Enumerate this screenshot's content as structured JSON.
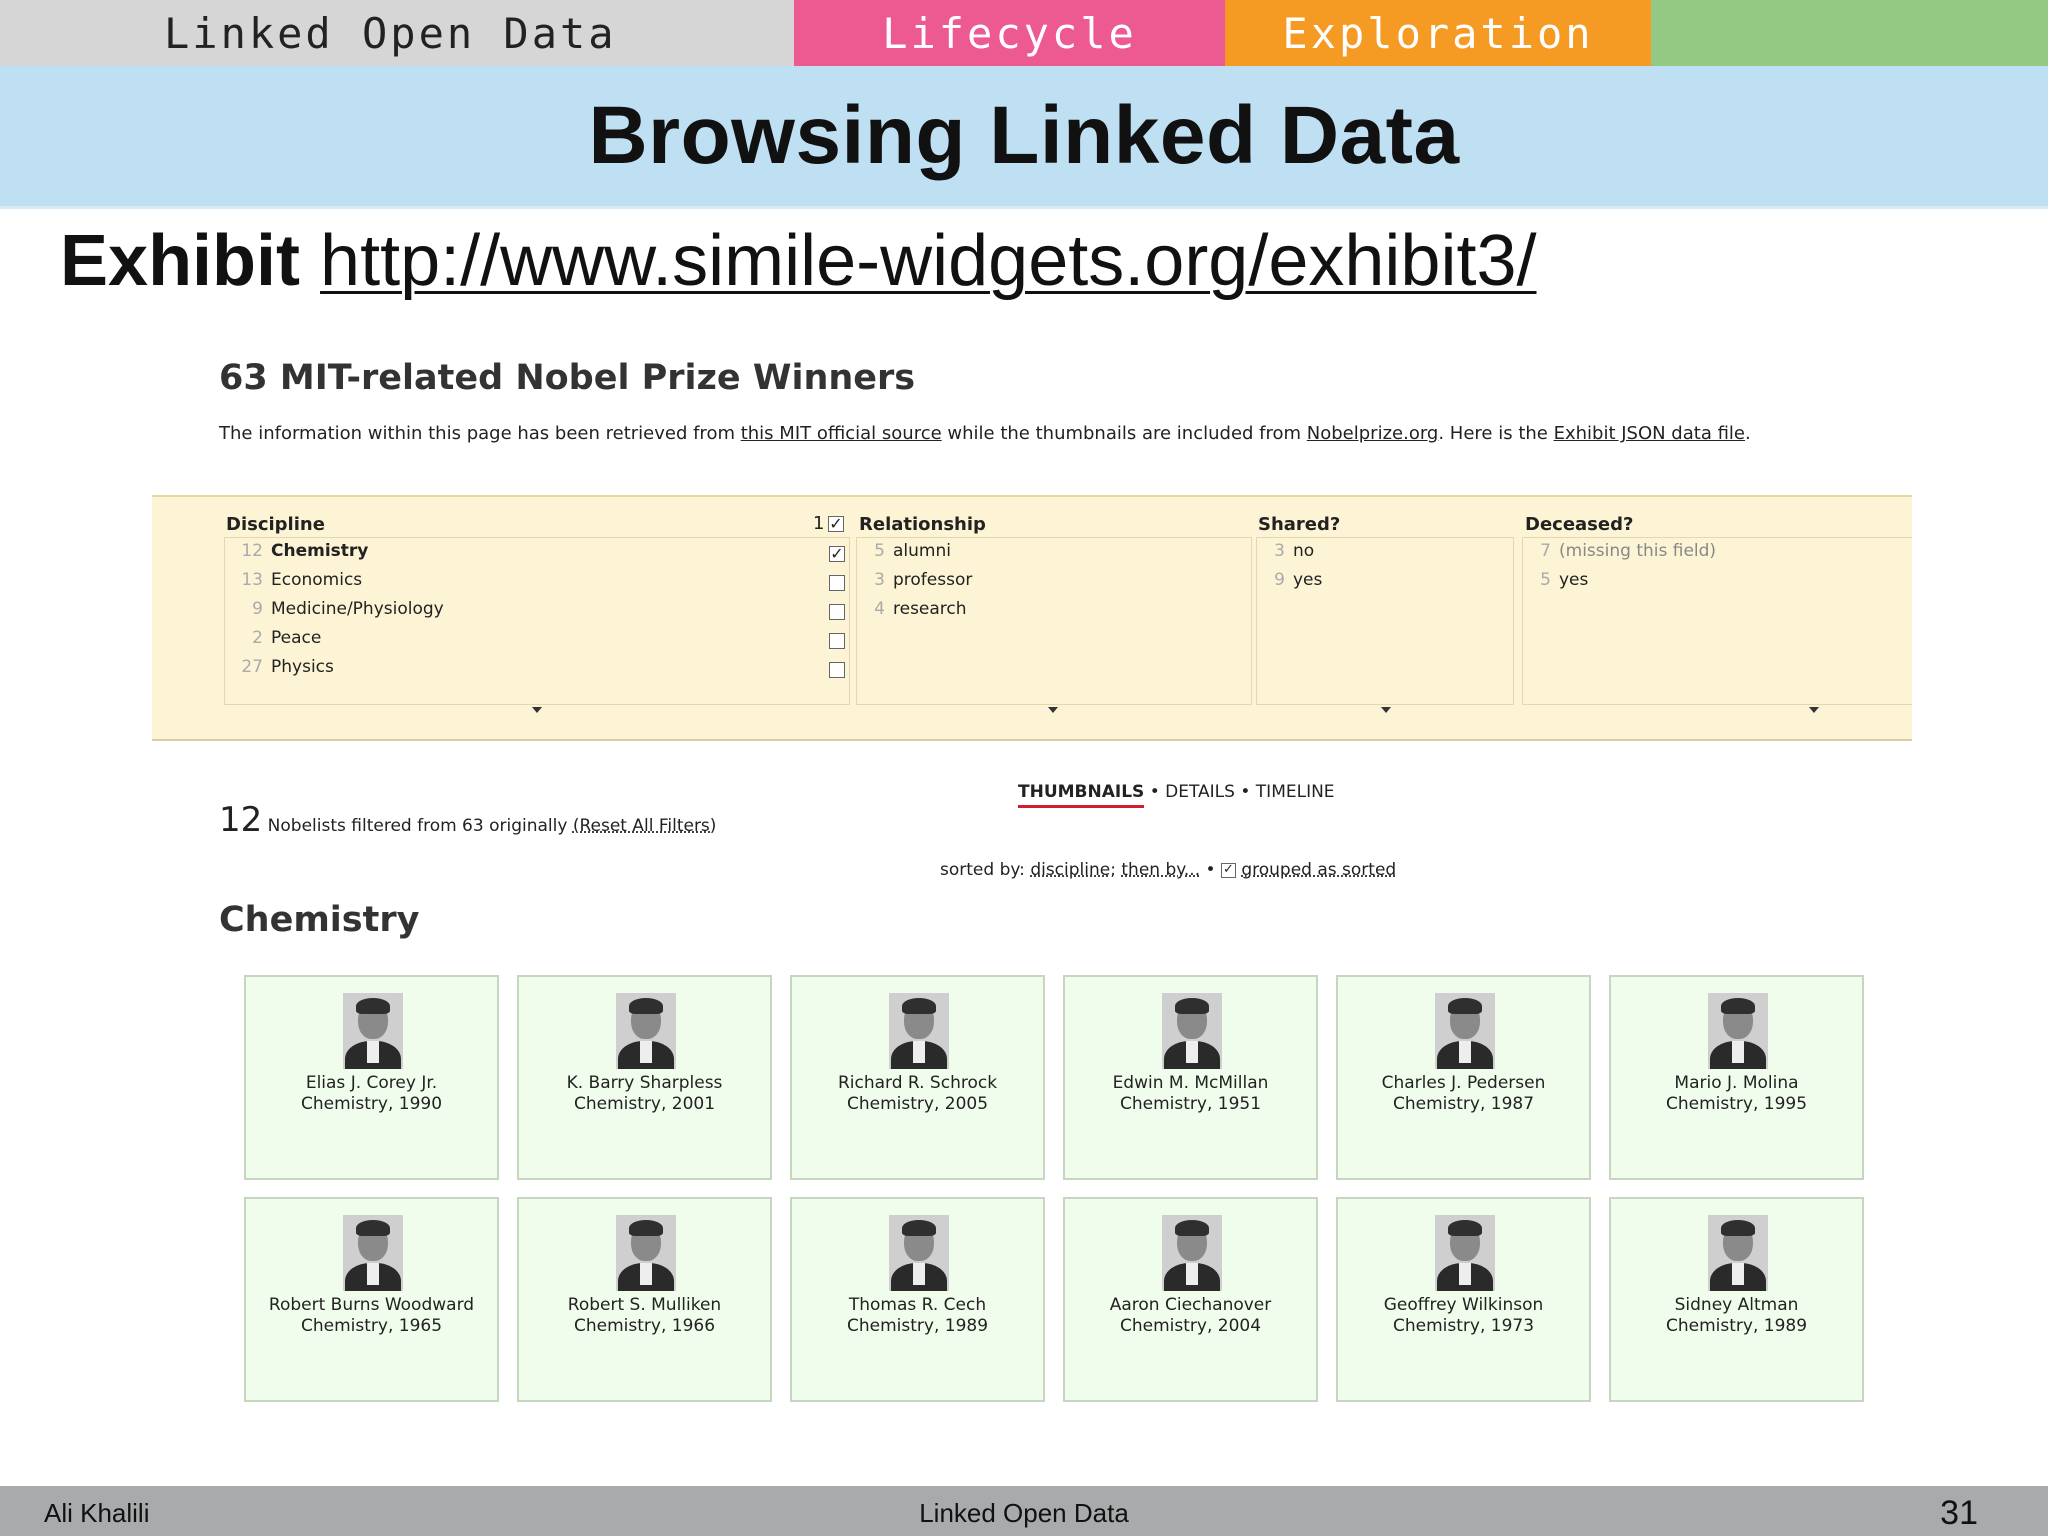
{
  "nav": {
    "tabs": [
      "Linked Open Data",
      "Lifecycle",
      "Exploration",
      ""
    ]
  },
  "slide": {
    "title": "Browsing Linked Data",
    "subtitle_bold": "Exhibit",
    "subtitle_link": "http://www.simile-widgets.org/exhibit3/"
  },
  "exhibit": {
    "title": "63 MIT-related Nobel Prize Winners",
    "desc_1": "The information within this page has been retrieved from ",
    "desc_link_1": "this MIT official source",
    "desc_2": " while the thumbnails are included from ",
    "desc_link_2": "Nobelprize.org",
    "desc_3": ". Here is the ",
    "desc_link_3": "Exhibit JSON data file",
    "desc_4": ".",
    "facets": {
      "discipline": {
        "title": "Discipline",
        "selected_count": "1",
        "items": [
          {
            "count": "12",
            "label": "Chemistry",
            "checked": true
          },
          {
            "count": "13",
            "label": "Economics",
            "checked": false
          },
          {
            "count": "9",
            "label": "Medicine/Physiology",
            "checked": false
          },
          {
            "count": "2",
            "label": "Peace",
            "checked": false
          },
          {
            "count": "27",
            "label": "Physics",
            "checked": false
          }
        ]
      },
      "relationship": {
        "title": "Relationship",
        "items": [
          {
            "count": "5",
            "label": "alumni"
          },
          {
            "count": "3",
            "label": "professor"
          },
          {
            "count": "4",
            "label": "research"
          }
        ]
      },
      "shared": {
        "title": "Shared?",
        "items": [
          {
            "count": "3",
            "label": "no"
          },
          {
            "count": "9",
            "label": "yes"
          }
        ]
      },
      "deceased": {
        "title": "Deceased?",
        "items": [
          {
            "count": "7",
            "label": "(missing this field)"
          },
          {
            "count": "5",
            "label": "yes"
          }
        ]
      }
    },
    "views": {
      "thumbnails": "THUMBNAILS",
      "sep": " • ",
      "details": "DETAILS",
      "timeline": "TIMELINE"
    },
    "results": {
      "count": "12",
      "text": " Nobelists filtered from 63 originally ",
      "reset": "(Reset All Filters)"
    },
    "sorting": {
      "prefix": "sorted by: ",
      "by": "discipline",
      "sep": "; ",
      "then": "then by...",
      "bullet": " • ",
      "check": "✓",
      "grouped": "grouped as sorted"
    },
    "group_title": "Chemistry",
    "cards": [
      {
        "name": "Elias J. Corey Jr.",
        "detail": "Chemistry, 1990"
      },
      {
        "name": "K. Barry Sharpless",
        "detail": "Chemistry, 2001"
      },
      {
        "name": "Richard R. Schrock",
        "detail": "Chemistry, 2005"
      },
      {
        "name": "Edwin M. McMillan",
        "detail": "Chemistry, 1951"
      },
      {
        "name": "Charles J. Pedersen",
        "detail": "Chemistry, 1987"
      },
      {
        "name": "Mario J. Molina",
        "detail": "Chemistry, 1995"
      },
      {
        "name": "Robert Burns Woodward",
        "detail": "Chemistry, 1965"
      },
      {
        "name": "Robert S. Mulliken",
        "detail": "Chemistry, 1966"
      },
      {
        "name": "Thomas R. Cech",
        "detail": "Chemistry, 1989"
      },
      {
        "name": "Aaron Ciechanover",
        "detail": "Chemistry, 2004"
      },
      {
        "name": "Geoffrey Wilkinson",
        "detail": "Chemistry, 1973"
      },
      {
        "name": "Sidney Altman",
        "detail": "Chemistry, 1989"
      }
    ]
  },
  "footer": {
    "author": "Ali Khalili",
    "course": "Linked Open Data",
    "page": "31"
  }
}
